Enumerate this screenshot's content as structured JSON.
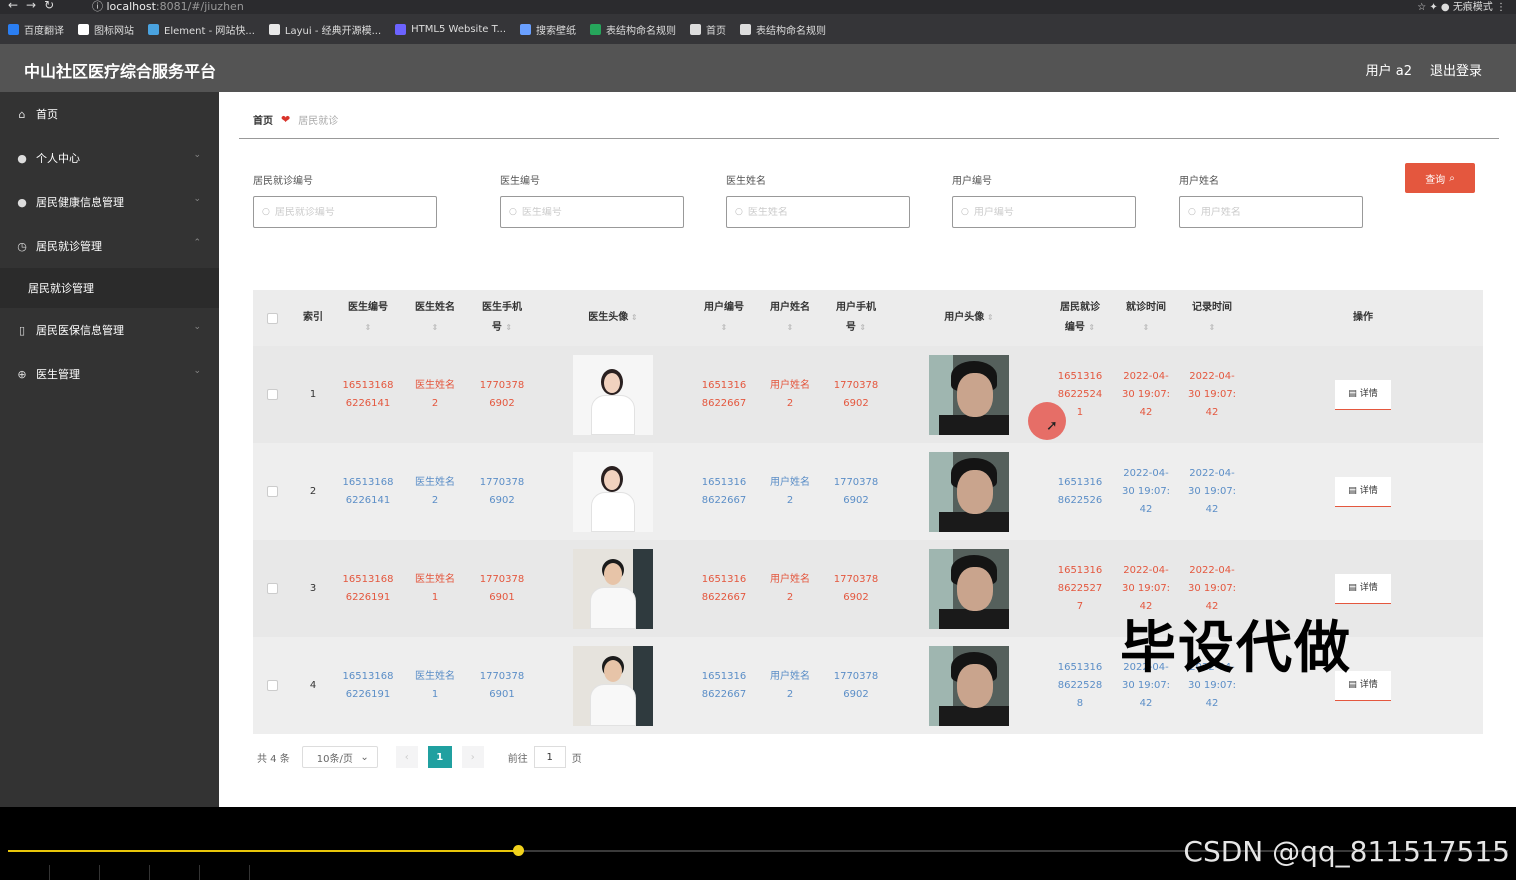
{
  "browser": {
    "url_host": "localhost",
    "url_path": ":8081/#/jiuzhen",
    "profile_label": "无痕模式",
    "bookmarks": [
      "百度翻译",
      "图标网站",
      "Element - 网站快...",
      "Layui - 经典开源模...",
      "HTML5 Website T...",
      "搜索壁纸",
      "表结构命名规则",
      "首页",
      "表结构命名规则"
    ]
  },
  "header": {
    "title": "中山社区医疗综合服务平台",
    "user": "用户 a2",
    "logout": "退出登录"
  },
  "sidebar": {
    "items": [
      {
        "label": "首页",
        "icon": "home-icon",
        "glyph": "⌂"
      },
      {
        "label": "个人中心",
        "icon": "person-icon",
        "glyph": "●"
      },
      {
        "label": "居民健康信息管理",
        "icon": "user-icon",
        "glyph": "●"
      },
      {
        "label": "居民就诊管理",
        "icon": "clock-icon",
        "glyph": "◷"
      },
      {
        "label": "居民医保信息管理",
        "icon": "phone-icon",
        "glyph": "▯"
      },
      {
        "label": "医生管理",
        "icon": "globe-icon",
        "glyph": "⊕"
      }
    ],
    "sub_item": "居民就诊管理"
  },
  "breadcrumb": {
    "home": "首页",
    "current": "居民就诊"
  },
  "search": {
    "fields": [
      {
        "label": "居民就诊编号",
        "placeholder": "居民就诊编号"
      },
      {
        "label": "医生编号",
        "placeholder": "医生编号"
      },
      {
        "label": "医生姓名",
        "placeholder": "医生姓名"
      },
      {
        "label": "用户编号",
        "placeholder": "用户编号"
      },
      {
        "label": "用户姓名",
        "placeholder": "用户姓名"
      }
    ],
    "button": "查询"
  },
  "table": {
    "headers": {
      "index": "索引",
      "doc_no": [
        "医生编号"
      ],
      "doc_name": [
        "医生姓名"
      ],
      "doc_phone": [
        "医生手机",
        "号"
      ],
      "doc_avatar": "医生头像",
      "user_no": [
        "用户编号"
      ],
      "user_name": [
        "用户姓名"
      ],
      "user_phone": [
        "用户手机",
        "号"
      ],
      "user_avatar": "用户头像",
      "visit_no": [
        "居民就诊",
        "编号"
      ],
      "visit_time": [
        "就诊时间"
      ],
      "record_time": [
        "记录时间"
      ],
      "action": "操作"
    },
    "rows": [
      {
        "index": "1",
        "doc_no": [
          "16513168",
          "6226141"
        ],
        "doc_name": [
          "医生姓名",
          "2"
        ],
        "doc_phone": [
          "1770378",
          "6902"
        ],
        "user_no": [
          "1651316",
          "8622667"
        ],
        "user_name": [
          "用户姓名",
          "2"
        ],
        "user_phone": [
          "1770378",
          "6902"
        ],
        "visit_no": [
          "1651316",
          "8622524",
          "1"
        ],
        "visit_time": [
          "2022-04-",
          "30 19:07:",
          "42"
        ],
        "record_time": [
          "2022-04-",
          "30 19:07:",
          "42"
        ],
        "detail": "详情",
        "color": "red",
        "doc_gender": "female"
      },
      {
        "index": "2",
        "doc_no": [
          "16513168",
          "6226141"
        ],
        "doc_name": [
          "医生姓名",
          "2"
        ],
        "doc_phone": [
          "1770378",
          "6902"
        ],
        "user_no": [
          "1651316",
          "8622667"
        ],
        "user_name": [
          "用户姓名",
          "2"
        ],
        "user_phone": [
          "1770378",
          "6902"
        ],
        "visit_no": [
          "1651316",
          "8622526"
        ],
        "visit_time": [
          "2022-04-",
          "30 19:07:",
          "42"
        ],
        "record_time": [
          "2022-04-",
          "30 19:07:",
          "42"
        ],
        "detail": "详情",
        "color": "blue",
        "doc_gender": "female"
      },
      {
        "index": "3",
        "doc_no": [
          "16513168",
          "6226191"
        ],
        "doc_name": [
          "医生姓名",
          "1"
        ],
        "doc_phone": [
          "1770378",
          "6901"
        ],
        "user_no": [
          "1651316",
          "8622667"
        ],
        "user_name": [
          "用户姓名",
          "2"
        ],
        "user_phone": [
          "1770378",
          "6902"
        ],
        "visit_no": [
          "1651316",
          "8622527",
          "7"
        ],
        "visit_time": [
          "2022-04-",
          "30 19:07:",
          "42"
        ],
        "record_time": [
          "2022-04-",
          "30 19:07:",
          "42"
        ],
        "detail": "详情",
        "color": "red",
        "doc_gender": "male"
      },
      {
        "index": "4",
        "doc_no": [
          "16513168",
          "6226191"
        ],
        "doc_name": [
          "医生姓名",
          "1"
        ],
        "doc_phone": [
          "1770378",
          "6901"
        ],
        "user_no": [
          "1651316",
          "8622667"
        ],
        "user_name": [
          "用户姓名",
          "2"
        ],
        "user_phone": [
          "1770378",
          "6902"
        ],
        "visit_no": [
          "1651316",
          "8622528",
          "8"
        ],
        "visit_time": [
          "2022-04-",
          "30 19:07:",
          "42"
        ],
        "record_time": [
          "2022-04-",
          "30 19:07:",
          "42"
        ],
        "detail": "详情",
        "color": "blue",
        "doc_gender": "male"
      }
    ]
  },
  "pagination": {
    "total": "共 4 条",
    "page_size": "10条/页",
    "current": "1",
    "goto_label": "前往",
    "goto_value": "1",
    "page_suffix": "页"
  },
  "watermark": "毕设代做",
  "video": {
    "credit": "CSDN @qq_811517515",
    "progress": 0.34
  },
  "colors": {
    "accent": "#e4573e",
    "link": "#5b8ec7",
    "pager_active": "#20a0a0",
    "sidebar": "#333333",
    "topbar": "#545454"
  }
}
